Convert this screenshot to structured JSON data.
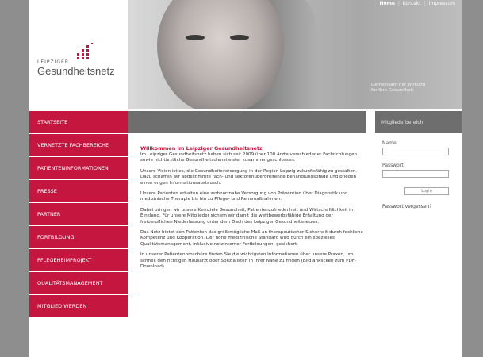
{
  "topnav": {
    "home": "Home",
    "contact": "Kontakt",
    "imprint": "Impressum",
    "separator": "|"
  },
  "logo": {
    "small": "LEIPZIGER",
    "big": "Gesundheitsnetz"
  },
  "hero": {
    "slogan_line1": "Gemeinsam mit Wirkung",
    "slogan_line2": "für Ihre Gesundheit"
  },
  "sidebar": {
    "items": [
      {
        "label": "STARTSEITE"
      },
      {
        "label": "VERNETZTE FACHBEREICHE"
      },
      {
        "label": "PATIENTENINFORMATIONEN"
      },
      {
        "label": "PRESSE"
      },
      {
        "label": "PARTNER"
      },
      {
        "label": "FORTBILDUNG"
      },
      {
        "label": "PFLEGEHEIMPROJEKT"
      },
      {
        "label": "QUALITÄTSMANAGEMENT"
      },
      {
        "label": "MITGLIED WERDEN"
      }
    ]
  },
  "member_area": {
    "title": "Mitgliederbereich"
  },
  "login": {
    "name_label": "Name",
    "password_label": "Passwort",
    "login_button": "Login",
    "forgot": "Passwort vergessen?"
  },
  "content": {
    "heading": "Willkommen im Leipziger Gesundheitsnetz",
    "paragraphs": [
      "Im Leipziger Gesundheitsnetz haben sich seit 2009 über 100 Ärzte verschiedener Fachrichtungen sowie nichtärztliche Gesundheitsdienstleister zusammengeschlossen.",
      "Unsere Vision ist es, die Gesundheitsversorgung in der Region Leipzig zukunftsfähig zu gestalten. Dazu schaffen wir abgestimmte fach- und sektorenübergreifende Behandlungspfade und pflegen einen engen Informationsaustausch.",
      "Unsere Patienten erhalten eine wohnortnahe Versorgung von Prävention über Diagnostik und medizinische Therapie bis hin zu Pflege- und Rehamaßnahmen.",
      "Dabei bringen wir unsere Kernziele Gesundheit, Patientenzufriedenheit und Wirtschaftlichkeit in Einklang. Für unsere Mitglieder sichern wir damit die wettbewerbsfähige Erhaltung der freiberuflichen Niederlassung unter dem Dach des Leipziger Gesundheitsnetzes.",
      "Das Netz bietet den Patienten das größtmögliche Maß an therapeutischer Sicherheit durch fachliche Kompetenz und Kooperation. Der hohe medizinische Standard wird durch ein spezielles Qualitätsmanagement, inklusive netzinterner Fortbildungen, gesichert.",
      "In unserer Patientenbroschüre finden Sie die wichtigsten Informationen über unsere Praxen, um schnell den richtigen Hausarzt oder Spezialisten in Ihrer Nähe zu finden (Bild anklicken zum PDF-Download)."
    ]
  },
  "colors": {
    "accent": "#c4163f",
    "dark_bar": "#6e6e6e",
    "background": "#8e8e8e"
  }
}
